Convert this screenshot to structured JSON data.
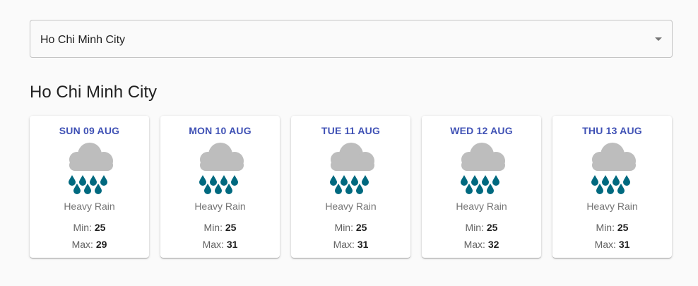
{
  "location_select": {
    "value": "Ho Chi Minh City"
  },
  "city_title": "Ho Chi Minh City",
  "labels": {
    "min": "Min:",
    "max": "Max:"
  },
  "colors": {
    "day_label": "#3f51b5",
    "cloud": "#bdbdbd",
    "rain": "#00697f"
  },
  "forecast": [
    {
      "day": "SUN 09 AUG",
      "icon": "heavy-rain-icon",
      "condition": "Heavy Rain",
      "min": "25",
      "max": "29"
    },
    {
      "day": "MON 10 AUG",
      "icon": "heavy-rain-icon",
      "condition": "Heavy Rain",
      "min": "25",
      "max": "31"
    },
    {
      "day": "TUE 11 AUG",
      "icon": "heavy-rain-icon",
      "condition": "Heavy Rain",
      "min": "25",
      "max": "31"
    },
    {
      "day": "WED 12 AUG",
      "icon": "heavy-rain-icon",
      "condition": "Heavy Rain",
      "min": "25",
      "max": "32"
    },
    {
      "day": "THU 13 AUG",
      "icon": "heavy-rain-icon",
      "condition": "Heavy Rain",
      "min": "25",
      "max": "31"
    }
  ]
}
